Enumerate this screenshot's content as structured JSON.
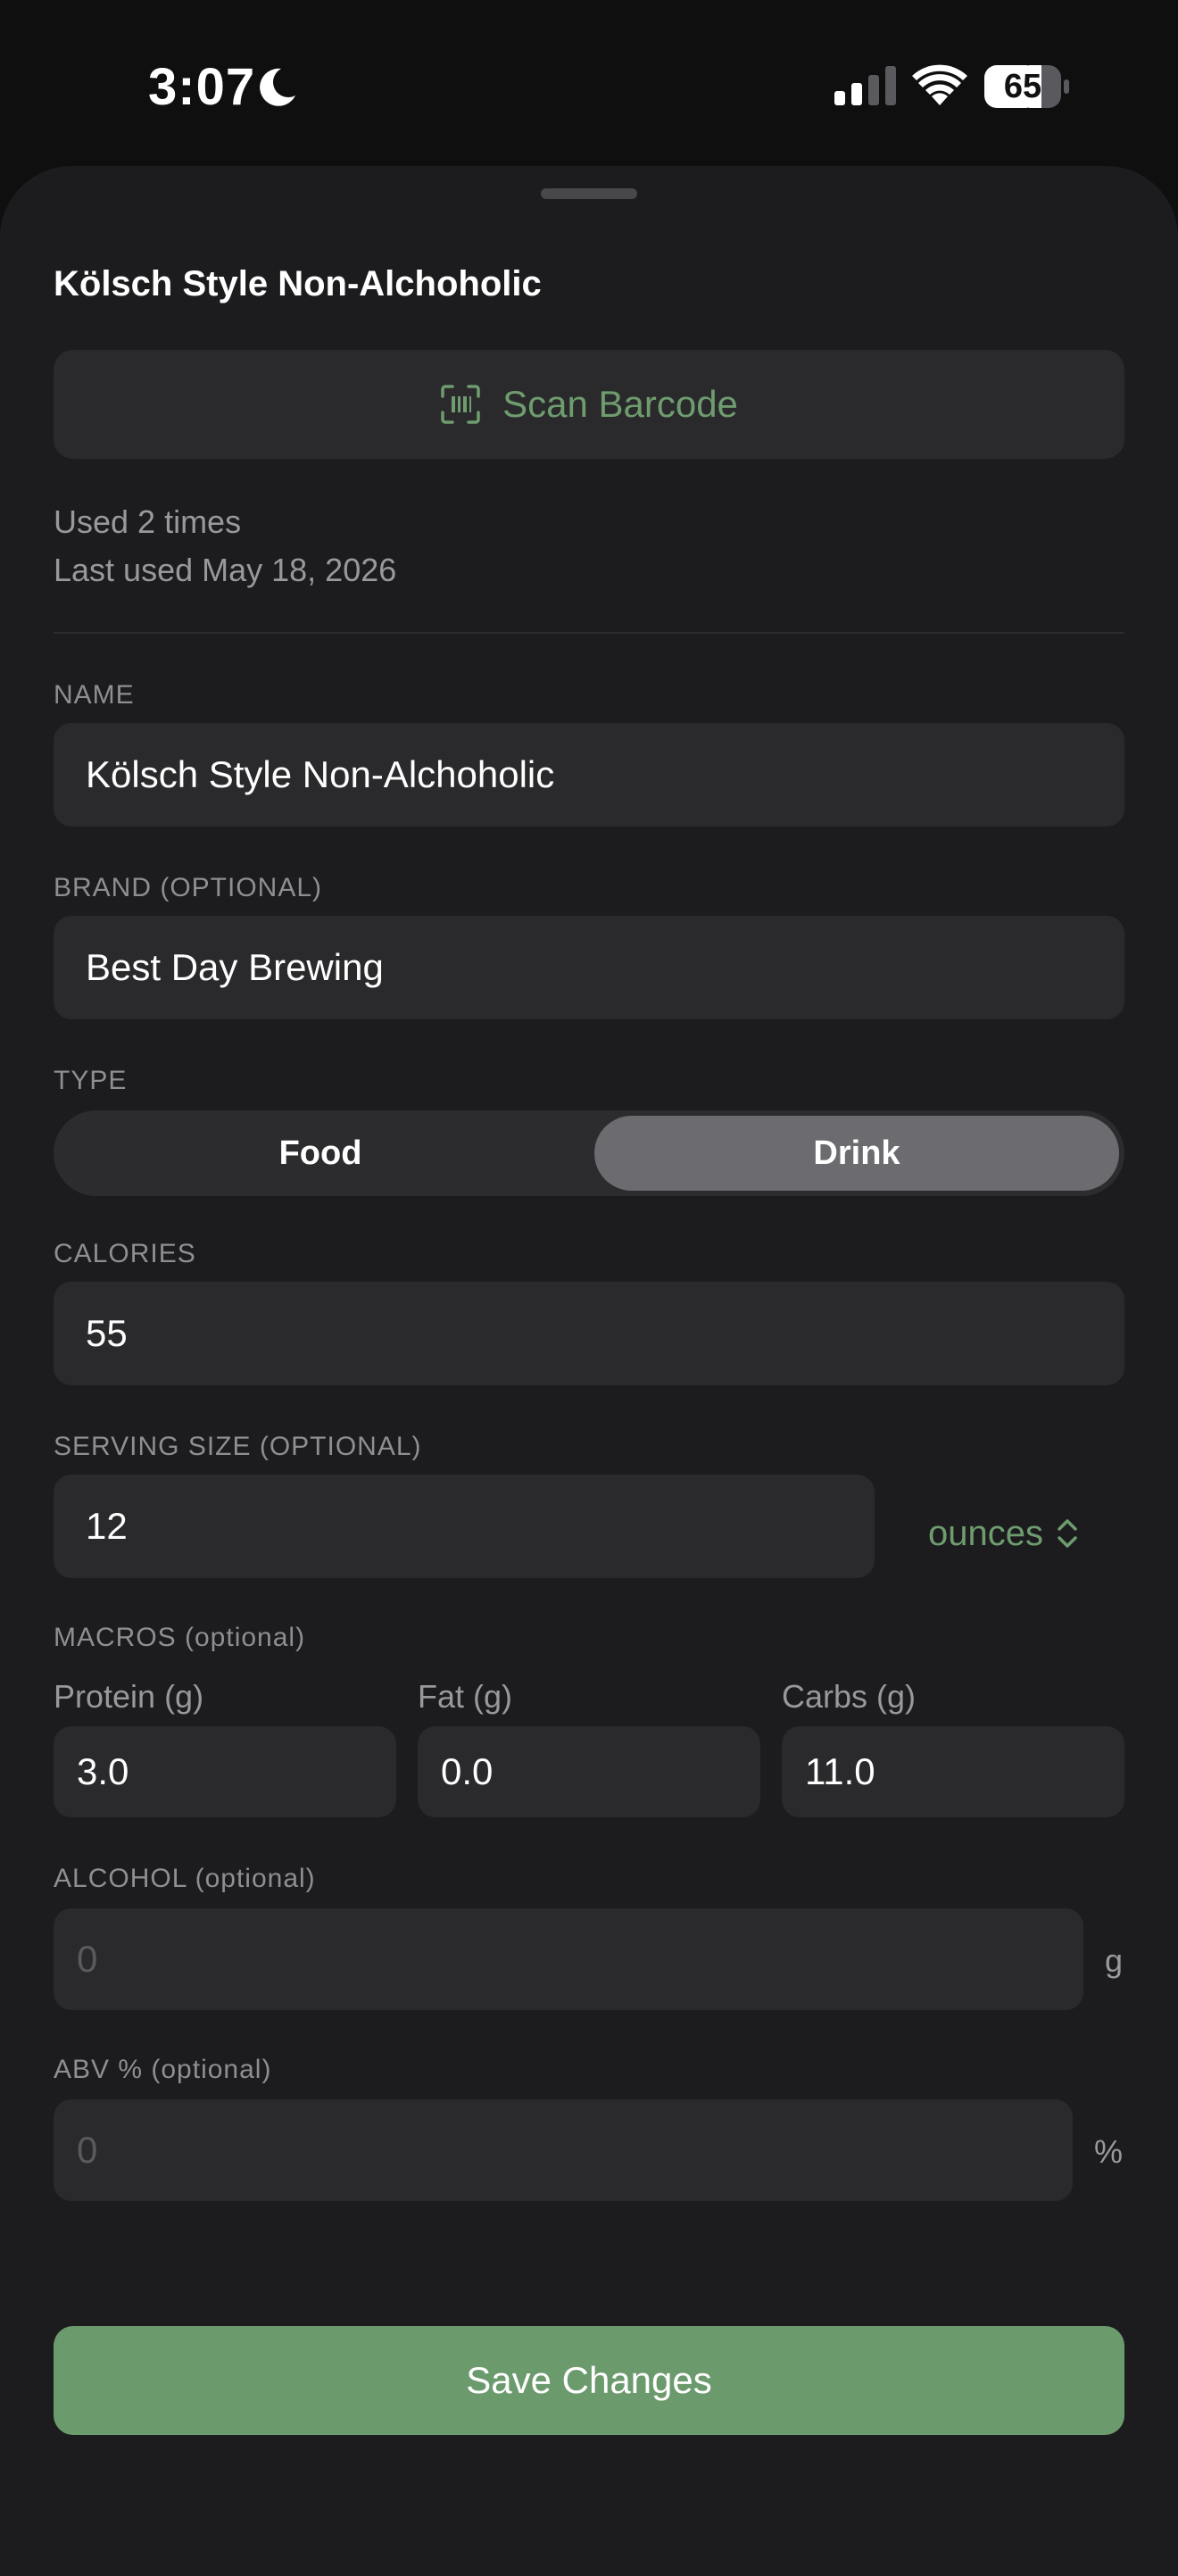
{
  "status": {
    "time": "3:07",
    "battery": "65"
  },
  "sheet": {
    "title": "Kölsch Style Non-Alchoholic",
    "scan_label": "Scan Barcode",
    "usage": [
      "Used 2 times",
      "Last used May 18, 2026"
    ]
  },
  "form": {
    "name": {
      "label": "NAME",
      "value": "Kölsch Style Non-Alchoholic"
    },
    "brand": {
      "label": "BRAND (OPTIONAL)",
      "value": "Best Day Brewing"
    },
    "type": {
      "label": "TYPE",
      "options": [
        "Food",
        "Drink"
      ],
      "selected": "Drink"
    },
    "calories": {
      "label": "CALORIES",
      "value": "55"
    },
    "serving": {
      "label": "SERVING SIZE (OPTIONAL)",
      "value": "12",
      "unit": "ounces"
    },
    "macros": {
      "label": "MACROS (optional)",
      "protein": {
        "label": "Protein (g)",
        "value": "3.0"
      },
      "fat": {
        "label": "Fat (g)",
        "value": "0.0"
      },
      "carbs": {
        "label": "Carbs (g)",
        "value": "11.0"
      }
    },
    "alcohol": {
      "label": "ALCOHOL (optional)",
      "placeholder": "0",
      "suffix": "g"
    },
    "abv": {
      "label": "ABV % (optional)",
      "placeholder": "0",
      "suffix": "%"
    }
  },
  "save_label": "Save Changes",
  "colors": {
    "accent": "#6b9a6d",
    "background": "#1c1c1e",
    "field": "#2a2a2c"
  },
  "icons": [
    "moon-icon",
    "signal-icon",
    "wifi-icon",
    "battery-icon",
    "barcode-scan-icon",
    "chevron-up-down-icon"
  ]
}
